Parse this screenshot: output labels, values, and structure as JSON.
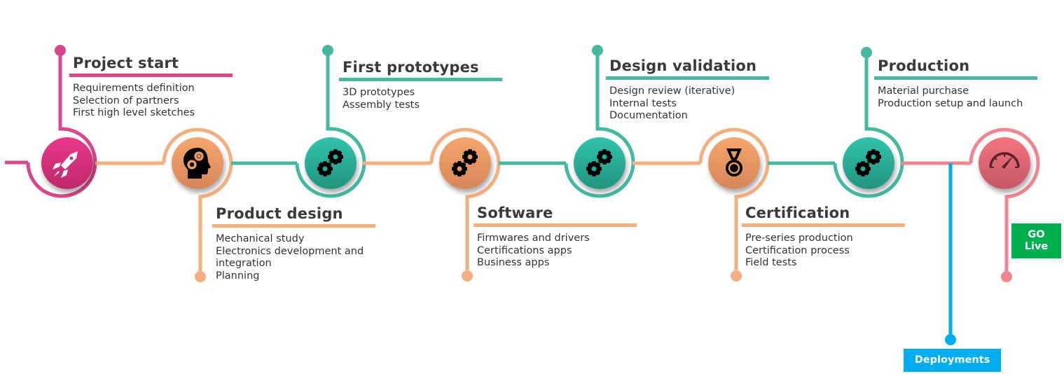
{
  "colors": {
    "pink": "#d9478a",
    "orange": "#f4ae80",
    "teal": "#45b8a2",
    "red": "#f08590",
    "blue": "#00aeef",
    "green": "#00b050"
  },
  "stages": [
    {
      "title": "Project start",
      "items": [
        "Requirements definition",
        "Selection of partners",
        "First high level sketches"
      ],
      "icon": "rocket-icon"
    },
    {
      "title": "Product design",
      "items": [
        "Mechanical study",
        "Electronics development and",
        "integration",
        "Planning"
      ],
      "icon": "head-gears-icon"
    },
    {
      "title": "First prototypes",
      "items": [
        "3D prototypes",
        "Assembly tests"
      ],
      "icon": "gears-icon"
    },
    {
      "title": "Software",
      "items": [
        "Firmwares and drivers",
        "Certifications apps",
        "Business apps"
      ],
      "icon": "gears-icon"
    },
    {
      "title": "Design validation",
      "items": [
        "Design review (iterative)",
        "Internal tests",
        "Documentation"
      ],
      "icon": "gears-icon"
    },
    {
      "title": "Certification",
      "items": [
        "Pre-series production",
        "Certification process",
        "Field tests"
      ],
      "icon": "medal-icon"
    },
    {
      "title": "Production",
      "items": [
        "Material purchase",
        "Production setup and launch"
      ],
      "icon": "gears-icon"
    }
  ],
  "final_icon": "speedometer-icon",
  "go_live": {
    "line1": "GO",
    "line2": "Live"
  },
  "deployments": "Deployments"
}
